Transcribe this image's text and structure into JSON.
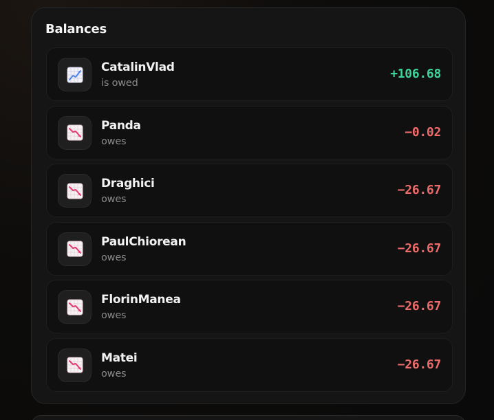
{
  "balances": {
    "title": "Balances",
    "rows": [
      {
        "name": "CatalinVlad",
        "status": "is owed",
        "amount": "+106.68",
        "icon": "chart-increasing-icon"
      },
      {
        "name": "Panda",
        "status": "owes",
        "amount": "−0.02",
        "icon": "chart-decreasing-icon"
      },
      {
        "name": "Draghici",
        "status": "owes",
        "amount": "−26.67",
        "icon": "chart-decreasing-icon"
      },
      {
        "name": "PaulChiorean",
        "status": "owes",
        "amount": "−26.67",
        "icon": "chart-decreasing-icon"
      },
      {
        "name": "FlorinManea",
        "status": "owes",
        "amount": "−26.67",
        "icon": "chart-decreasing-icon"
      },
      {
        "name": "Matei",
        "status": "owes",
        "amount": "−26.67",
        "icon": "chart-decreasing-icon"
      }
    ]
  },
  "colors": {
    "positive": "#3fd39a",
    "negative": "#ef6b6b",
    "card_background": "#151515",
    "row_background": "#101010"
  }
}
